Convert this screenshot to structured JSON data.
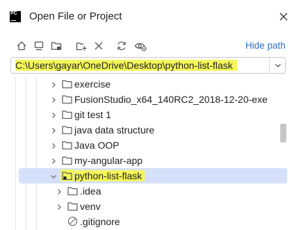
{
  "window": {
    "title": "Open File or Project",
    "app_logo_text": "PC"
  },
  "toolbar": {
    "buttons": [
      "home-icon",
      "desktop-icon",
      "project-folder-icon",
      "new-folder-icon",
      "delete-icon",
      "refresh-icon",
      "show-hidden-icon"
    ],
    "hide_path_label": "Hide path"
  },
  "path": {
    "value": "C:\\Users\\gayar\\OneDrive\\Desktop\\python-list-flask"
  },
  "tree": {
    "items": [
      {
        "label": "exercise",
        "type": "folder",
        "expanded": false,
        "selected": false
      },
      {
        "label": "FusionStudio_x64_140RC2_2018-12-20-exe",
        "type": "folder",
        "expanded": false,
        "selected": false
      },
      {
        "label": "git test 1",
        "type": "folder",
        "expanded": false,
        "selected": false
      },
      {
        "label": "java data structure",
        "type": "folder",
        "expanded": false,
        "selected": false
      },
      {
        "label": "Java OOP",
        "type": "folder",
        "expanded": false,
        "selected": false
      },
      {
        "label": "my-angular-app",
        "type": "folder",
        "expanded": false,
        "selected": false
      },
      {
        "label": "python-list-flask",
        "type": "project-folder",
        "expanded": true,
        "selected": true
      },
      {
        "label": ".idea",
        "type": "folder",
        "expanded": false,
        "selected": false
      },
      {
        "label": "venv",
        "type": "folder",
        "expanded": false,
        "selected": false
      },
      {
        "label": ".gitignore",
        "type": "ignored-file",
        "expanded": false,
        "selected": false
      }
    ]
  },
  "colors": {
    "accent_link": "#2f6ecb",
    "highlight": "#f5f75a",
    "selection": "#d5e1fb"
  }
}
